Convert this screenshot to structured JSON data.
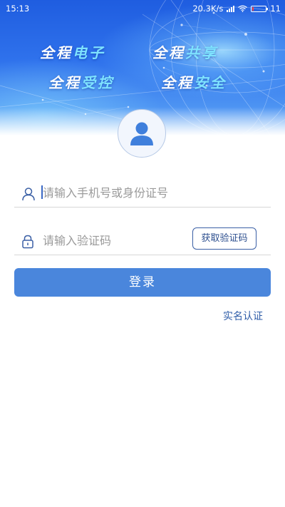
{
  "status_bar": {
    "time": "15:13",
    "network_speed": "20.3K/s",
    "battery_text": "11",
    "battery_level": 0.11,
    "icons": [
      "signal-icon",
      "wifi-icon",
      "battery-icon"
    ]
  },
  "banner": {
    "slogans": [
      {
        "prefix": "全程",
        "suffix": "电子"
      },
      {
        "prefix": "全程",
        "suffix": "共享"
      },
      {
        "prefix": "全程",
        "suffix": "受控"
      },
      {
        "prefix": "全程",
        "suffix": "安全"
      }
    ]
  },
  "login_form": {
    "avatar_icon": "user-avatar-icon",
    "phone_field": {
      "icon": "user-icon",
      "placeholder": "请输入手机号或身份证号",
      "value": ""
    },
    "code_field": {
      "icon": "lock-icon",
      "placeholder": "请输入验证码",
      "value": ""
    },
    "get_code_label": "获取验证码",
    "login_label": "登录",
    "realname_link": "实名认证"
  },
  "colors": {
    "primary": "#4a86dc",
    "link": "#2f5da8",
    "banner_accent": "#7fe3ff",
    "banner_blue": "#2f72ec"
  }
}
